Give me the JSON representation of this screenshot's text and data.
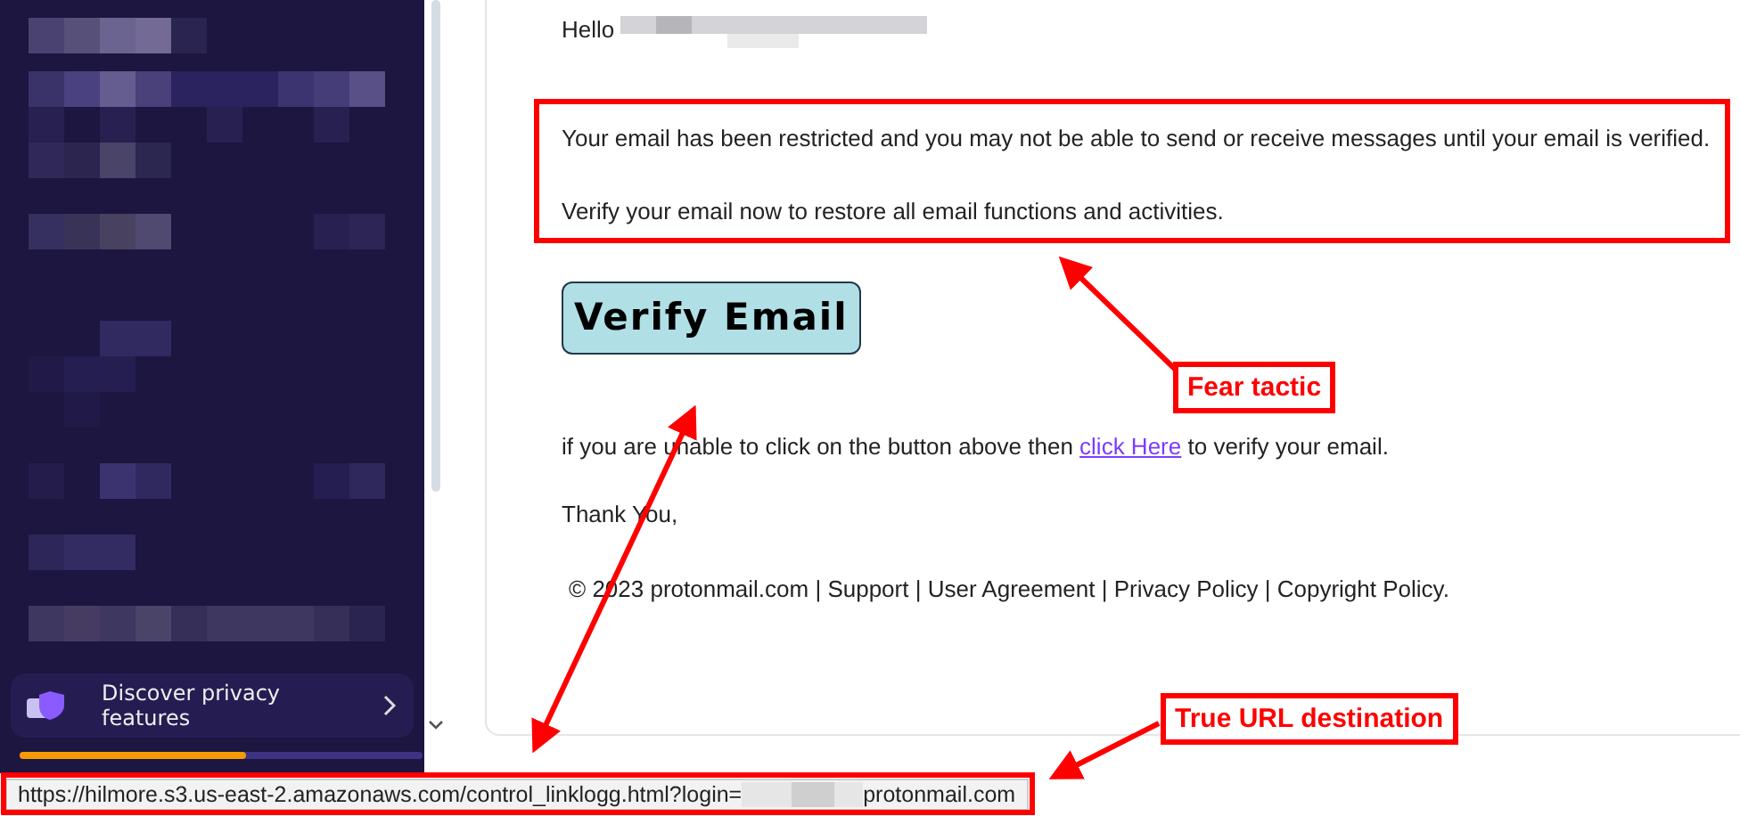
{
  "sidebar": {
    "promo": {
      "label": "Discover privacy features"
    },
    "progress": {
      "level": 0.56
    }
  },
  "email": {
    "greeting": "Hello",
    "paragraphs": [
      "Your email has been restricted and you may not be able to send or receive messages until your email is verified.",
      "Verify your email now to restore all email functions and activities."
    ],
    "button": "Verify Email",
    "fallback": {
      "before": "if you are unable to click on the button above then ",
      "link": "click Here",
      "after": " to verify your email."
    },
    "closing": "Thank You,",
    "footer": "© 2023 protonmail.com | Support | User Agreement | Privacy Policy | Copyright Policy."
  },
  "status_bar": {
    "url_start": "https://hilmore.s3.us-east-2.amazonaws.com/control_linklogg.html?login=",
    "url_end": "protonmail.com"
  },
  "annotations": [
    {
      "kind": "label",
      "text": "Fear tactic"
    },
    {
      "kind": "label",
      "text": "True URL destination"
    }
  ]
}
